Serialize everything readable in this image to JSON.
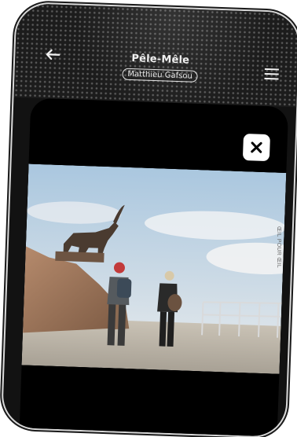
{
  "header": {
    "title": "Pêle-Mêle",
    "author": "Matthieu Gafsou"
  },
  "icons": {
    "back": "arrow-left-icon",
    "menu": "hamburger-menu-icon",
    "close": "close-icon"
  },
  "credit": "ŒIL POUR ŒIL",
  "colors": {
    "header_bg": "#1c1c1c",
    "panel_bg": "#000000",
    "close_bg": "#ffffff"
  }
}
